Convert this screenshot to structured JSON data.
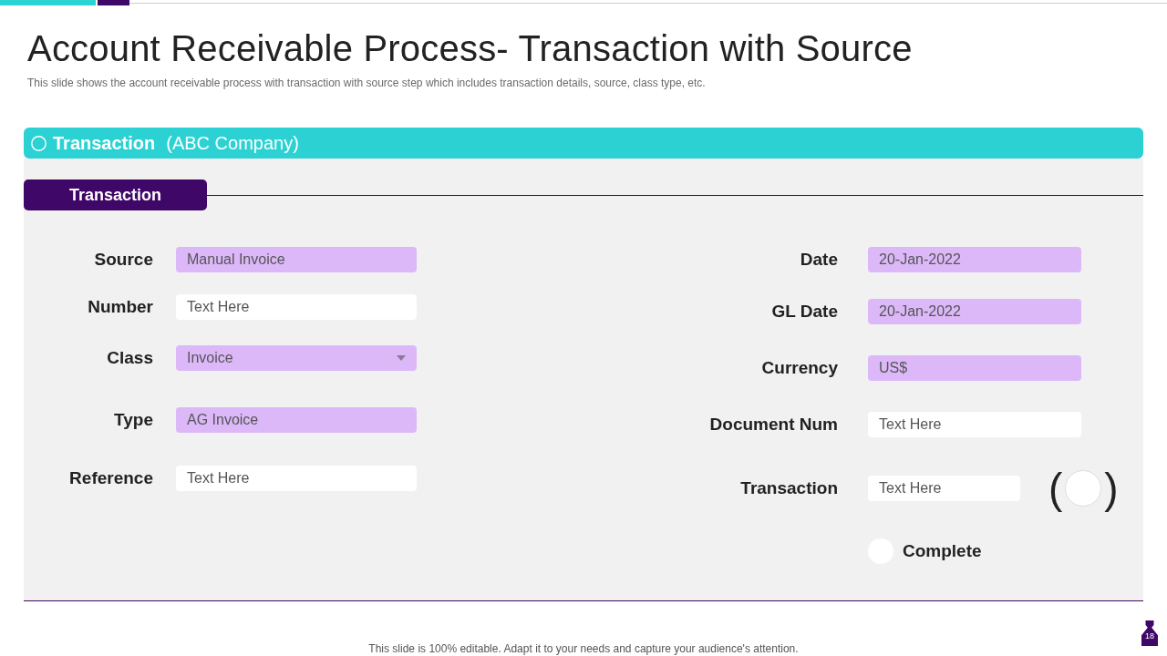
{
  "title": "Account Receivable Process- Transaction with Source",
  "subtitle": "This slide shows the account receivable process with transaction with source step which includes transaction details, source, class type, etc.",
  "banner": {
    "title": "Transaction",
    "company": "(ABC Company)"
  },
  "section": {
    "label": "Transaction"
  },
  "left_fields": [
    {
      "label": "Source",
      "value": "Manual Invoice",
      "kind": "filled"
    },
    {
      "label": "Number",
      "value": "Text Here",
      "kind": "input"
    },
    {
      "label": "Class",
      "value": "Invoice",
      "kind": "dropdown"
    },
    {
      "label": "Type",
      "value": "AG Invoice",
      "kind": "filled"
    },
    {
      "label": "Reference",
      "value": "Text Here",
      "kind": "input"
    }
  ],
  "right_fields": [
    {
      "label": "Date",
      "value": "20-Jan-2022",
      "kind": "filled"
    },
    {
      "label": "GL Date",
      "value": "20-Jan-2022",
      "kind": "filled"
    },
    {
      "label": "Currency",
      "value": "US$",
      "kind": "filled"
    },
    {
      "label": "Document Num",
      "value": "Text Here",
      "kind": "input"
    },
    {
      "label": "Transaction",
      "value": "Text Here",
      "kind": "input",
      "toggle": {
        "open": "(",
        "close": ")",
        "checked": false
      }
    }
  ],
  "complete": {
    "label": "Complete",
    "checked": false
  },
  "footer": {
    "note": "This slide is 100% editable. Adapt it to your needs and capture your audience's attention.",
    "page_number": "18"
  }
}
